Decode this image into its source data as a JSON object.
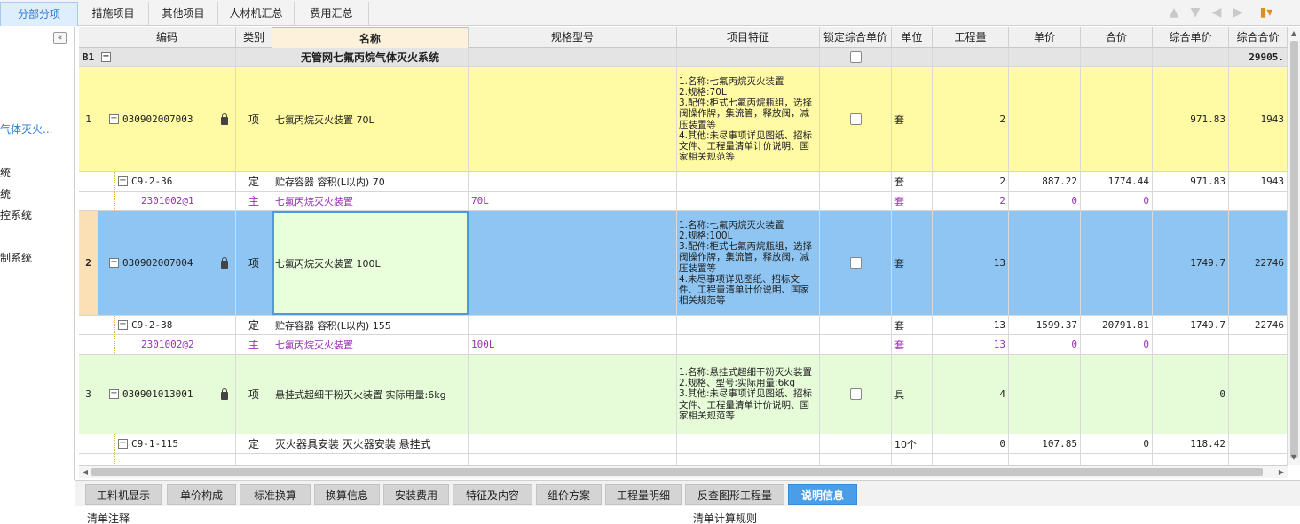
{
  "top_tabs": [
    "分部分项",
    "措施项目",
    "其他项目",
    "人材机汇总",
    "费用汇总"
  ],
  "top_icons": [
    "arrow-up-icon",
    "arrow-down-icon",
    "arrow-left-icon",
    "arrow-right-icon",
    "color-settings-icon"
  ],
  "left_panel": {
    "items": [
      "气体灭火...",
      "统",
      "统",
      "控系统",
      "制系统"
    ]
  },
  "columns": [
    "编码",
    "类别",
    "名称",
    "规格型号",
    "项目特征",
    "锁定综合单价",
    "单位",
    "工程量",
    "单价",
    "合价",
    "综合单价",
    "综合合价"
  ],
  "rows": [
    {
      "rownum": "B1",
      "code": "",
      "type": "",
      "name": "无管网七氟丙烷气体灭火系统",
      "spec": "",
      "feature": "",
      "unit": "",
      "qty": "",
      "price": "",
      "total": "",
      "comp_price": "",
      "comp_total": "29905."
    },
    {
      "rownum": "1",
      "code": "030902007003",
      "type": "项",
      "name": "七氟丙烷灭火装置 70L",
      "spec": "",
      "feature": "1.名称:七氟丙烷灭火装置\n2.规格:70L\n3.配件:柜式七氟丙烷瓶组，选择阀操作牌，集流管，释放阀，减压装置等\n4.其他:未尽事项详见图纸、招标文件、工程量清单计价说明、国家相关规范等",
      "unit": "套",
      "qty": "2",
      "price": "",
      "total": "",
      "comp_price": "971.83",
      "comp_total": "1943"
    },
    {
      "rownum": "",
      "code": "C9-2-36",
      "type": "定",
      "name": "贮存容器 容积(L以内) 70",
      "spec": "",
      "feature": "",
      "unit": "套",
      "qty": "2",
      "price": "887.22",
      "total": "1774.44",
      "comp_price": "971.83",
      "comp_total": "1943"
    },
    {
      "rownum": "",
      "code": "2301002@1",
      "type": "主",
      "name": "七氟丙烷灭火装置",
      "spec": "70L",
      "feature": "",
      "unit": "套",
      "qty": "2",
      "price": "0",
      "total": "0",
      "comp_price": "",
      "comp_total": ""
    },
    {
      "rownum": "2",
      "code": "030902007004",
      "type": "项",
      "name": "七氟丙烷灭火装置 100L",
      "spec": "",
      "feature": "1.名称:七氟丙烷灭火装置\n2.规格:100L\n3.配件:柜式七氟丙烷瓶组，选择阀操作牌，集流管，释放阀，减压装置等\n4.未尽事项详见图纸、招标文件、工程量清单计价说明、国家相关规范等",
      "unit": "套",
      "qty": "13",
      "price": "",
      "total": "",
      "comp_price": "1749.7",
      "comp_total": "22746"
    },
    {
      "rownum": "",
      "code": "C9-2-38",
      "type": "定",
      "name": "贮存容器 容积(L以内) 155",
      "spec": "",
      "feature": "",
      "unit": "套",
      "qty": "13",
      "price": "1599.37",
      "total": "20791.81",
      "comp_price": "1749.7",
      "comp_total": "22746"
    },
    {
      "rownum": "",
      "code": "2301002@2",
      "type": "主",
      "name": "七氟丙烷灭火装置",
      "spec": "100L",
      "feature": "",
      "unit": "套",
      "qty": "13",
      "price": "0",
      "total": "0",
      "comp_price": "",
      "comp_total": ""
    },
    {
      "rownum": "3",
      "code": "030901013001",
      "type": "项",
      "name": "悬挂式超细干粉灭火装置 实际用量:6kg",
      "spec": "",
      "feature": "1.名称:悬挂式超细干粉灭火装置\n2.规格、型号:实际用量:6kg\n3.其他:未尽事项详见图纸、招标文件、工程量清单计价说明、国家相关规范等",
      "unit": "具",
      "qty": "4",
      "price": "",
      "total": "",
      "comp_price": "0",
      "comp_total": ""
    },
    {
      "rownum": "",
      "code": "C9-1-115",
      "type": "定",
      "name": "灭火器具安装 灭火器安装 悬挂式",
      "spec": "",
      "feature": "",
      "unit": "10个",
      "qty": "0",
      "price": "107.85",
      "total": "0",
      "comp_price": "118.42",
      "comp_total": ""
    }
  ],
  "bottom_tabs": [
    "工料机显示",
    "单价构成",
    "标准换算",
    "换算信息",
    "安装费用",
    "特征及内容",
    "组价方案",
    "工程量明细",
    "反查图形工程量",
    "说明信息"
  ],
  "info": {
    "left_label": "清单注释",
    "right_label": "清单计算规则"
  },
  "colors": {
    "accent": "#2c7ad6",
    "active_tab": "#4a9ee8",
    "selected_row": "#8ec5f2",
    "item_row": "#fffaa3",
    "item_row_alt": "#e6fbd8",
    "main_material_text": "#9b2fb5"
  }
}
